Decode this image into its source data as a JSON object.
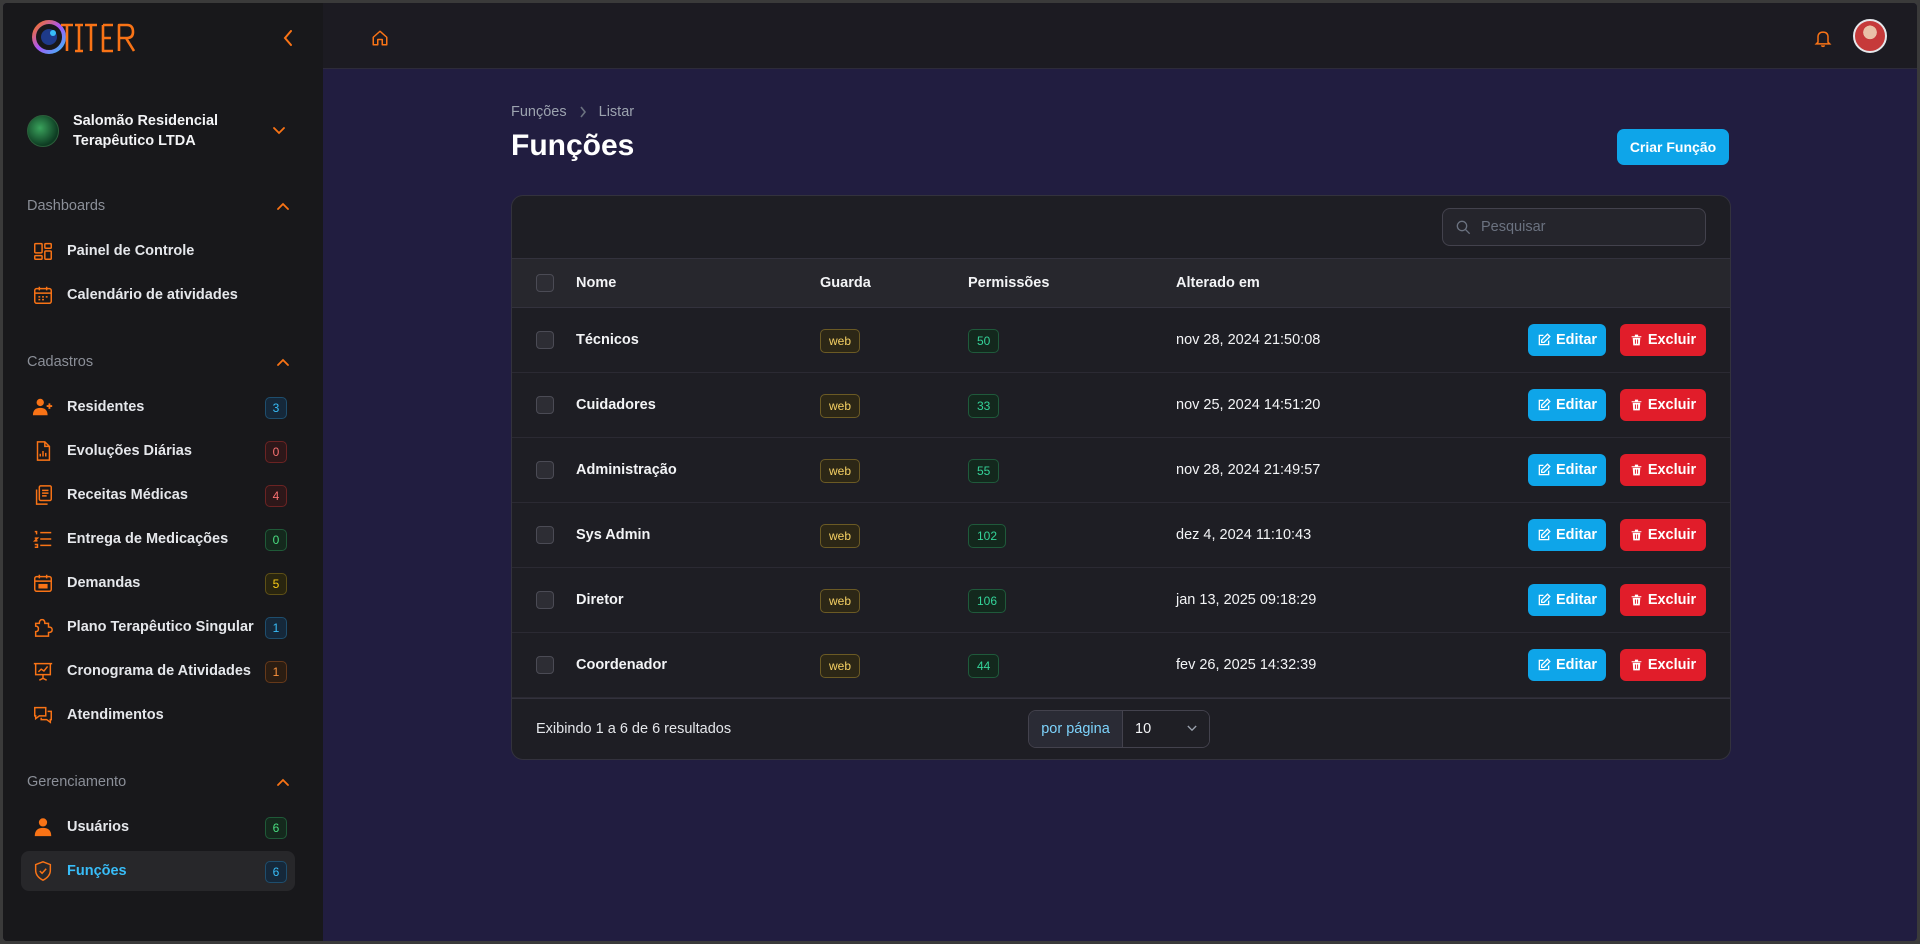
{
  "app": {
    "logo_text": "GITER"
  },
  "tenant": {
    "name": "Salomão Residencial Terapêutico LTDA"
  },
  "sidebar": {
    "groups": [
      {
        "label": "Dashboards",
        "items": [
          {
            "label": "Painel de Controle",
            "icon": "dashboard-icon"
          },
          {
            "label": "Calendário de atividades",
            "icon": "calendar-icon"
          }
        ]
      },
      {
        "label": "Cadastros",
        "items": [
          {
            "label": "Residentes",
            "icon": "user-plus-icon",
            "badge": "3"
          },
          {
            "label": "Evoluções Diárias",
            "icon": "document-chart-icon",
            "badge": "0"
          },
          {
            "label": "Receitas Médicas",
            "icon": "clipboard-copy-icon",
            "badge": "4"
          },
          {
            "label": "Entrega de Medicações",
            "icon": "numbered-list-icon",
            "badge": "0"
          },
          {
            "label": "Demandas",
            "icon": "calendar-date-icon",
            "badge": "5"
          },
          {
            "label": "Plano Terapêutico Singular",
            "icon": "puzzle-icon",
            "badge": "1"
          },
          {
            "label": "Cronograma de Atividades",
            "icon": "presentation-chart-icon",
            "badge": "1"
          },
          {
            "label": "Atendimentos",
            "icon": "chat-bubbles-icon"
          }
        ]
      },
      {
        "label": "Gerenciamento",
        "items": [
          {
            "label": "Usuários",
            "icon": "user-icon",
            "badge": "6"
          },
          {
            "label": "Funções",
            "icon": "shield-check-icon",
            "badge": "6",
            "active": true
          }
        ]
      }
    ]
  },
  "breadcrumb": {
    "parent": "Funções",
    "current": "Listar"
  },
  "page": {
    "title": "Funções",
    "create_label": "Criar Função"
  },
  "search": {
    "placeholder": "Pesquisar",
    "value": ""
  },
  "table": {
    "columns": {
      "name": "Nome",
      "guard": "Guarda",
      "permissions": "Permissões",
      "updated": "Alterado em"
    },
    "rows": [
      {
        "name": "Técnicos",
        "guard": "web",
        "permissions": "50",
        "updated": "nov 28, 2024 21:50:08"
      },
      {
        "name": "Cuidadores",
        "guard": "web",
        "permissions": "33",
        "updated": "nov 25, 2024 14:51:20"
      },
      {
        "name": "Administração",
        "guard": "web",
        "permissions": "55",
        "updated": "nov 28, 2024 21:49:57"
      },
      {
        "name": "Sys Admin",
        "guard": "web",
        "permissions": "102",
        "updated": "dez 4, 2024 11:10:43"
      },
      {
        "name": "Diretor",
        "guard": "web",
        "permissions": "106",
        "updated": "jan 13, 2025 09:18:29"
      },
      {
        "name": "Coordenador",
        "guard": "web",
        "permissions": "44",
        "updated": "fev 26, 2025 14:32:39"
      }
    ],
    "edit_label": "Editar",
    "delete_label": "Excluir"
  },
  "pagination": {
    "summary": "Exibindo 1 a 6 de 6 resultados",
    "per_page_label": "por página",
    "per_page_value": "10"
  },
  "colors": {
    "accent": "#0ea5e9",
    "danger": "#e11d2a",
    "icon_orange": "#f97316",
    "sidebar_bg": "#18181b",
    "main_bg": "#211d40"
  }
}
